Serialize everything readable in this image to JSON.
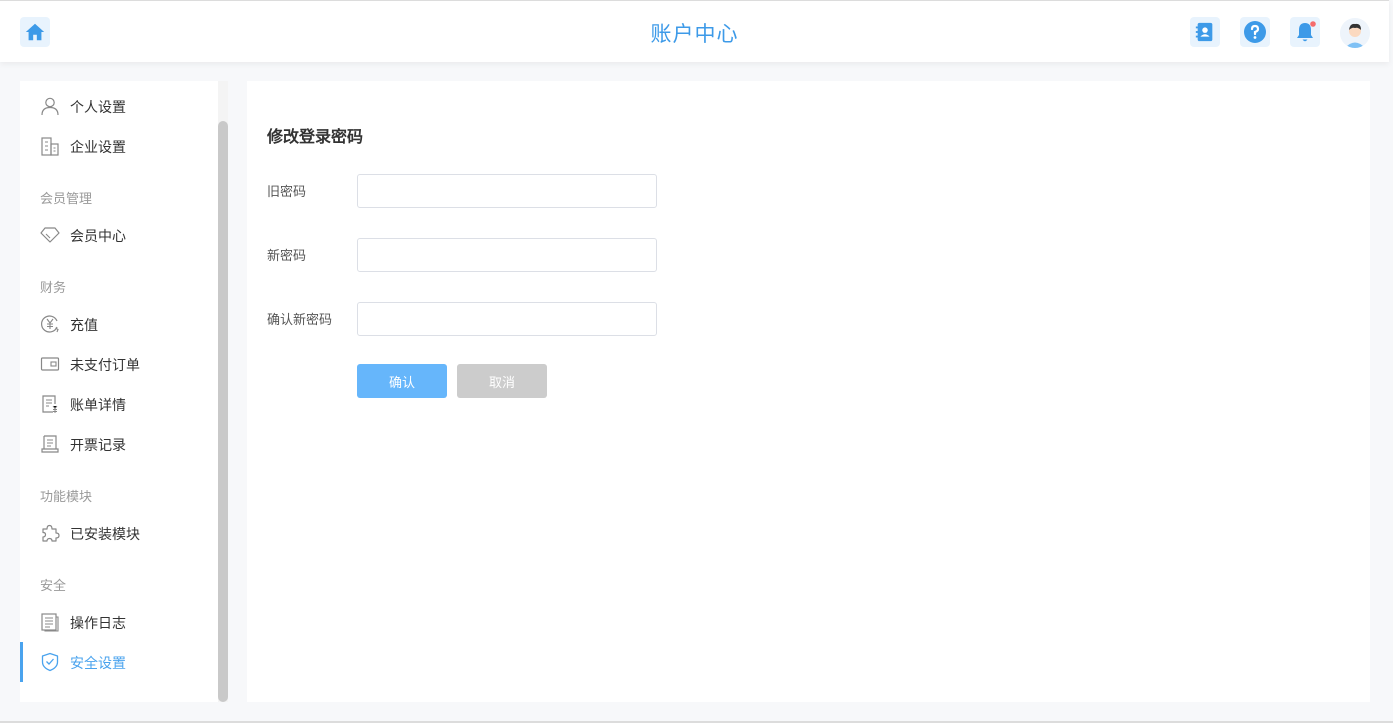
{
  "header": {
    "title": "账户中心",
    "icons": [
      "home-icon",
      "contacts-icon",
      "help-icon",
      "bell-icon",
      "avatar"
    ],
    "accent_color": "#3d9ae8",
    "notification_dot_color": "#f56c6c"
  },
  "sidebar": {
    "items": [
      {
        "label": "个人设置",
        "icon": "user-icon"
      },
      {
        "label": "企业设置",
        "icon": "building-icon"
      }
    ],
    "groups": [
      {
        "label": "会员管理",
        "items": [
          {
            "label": "会员中心",
            "icon": "diamond-icon"
          }
        ]
      },
      {
        "label": "财务",
        "items": [
          {
            "label": "充值",
            "icon": "yen-icon"
          },
          {
            "label": "未支付订单",
            "icon": "wallet-icon"
          },
          {
            "label": "账单详情",
            "icon": "bill-icon"
          },
          {
            "label": "开票记录",
            "icon": "invoice-icon"
          }
        ]
      },
      {
        "label": "功能模块",
        "items": [
          {
            "label": "已安装模块",
            "icon": "puzzle-icon"
          }
        ]
      },
      {
        "label": "安全",
        "items": [
          {
            "label": "操作日志",
            "icon": "log-icon"
          },
          {
            "label": "安全设置",
            "icon": "shield-check-icon",
            "active": true
          }
        ]
      }
    ]
  },
  "form": {
    "title": "修改登录密码",
    "fields": [
      {
        "label": "旧密码",
        "value": "",
        "placeholder": ""
      },
      {
        "label": "新密码",
        "value": "",
        "placeholder": ""
      },
      {
        "label": "确认新密码",
        "value": "",
        "placeholder": ""
      }
    ],
    "confirm_label": "确认",
    "cancel_label": "取消"
  }
}
